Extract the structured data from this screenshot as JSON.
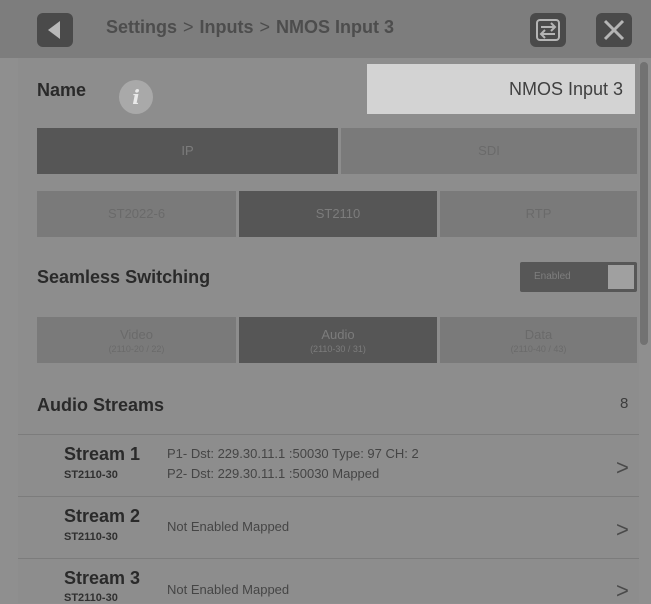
{
  "header": {
    "breadcrumb": [
      "Settings",
      "Inputs",
      "NMOS Input 3"
    ],
    "separator": ">"
  },
  "name_row": {
    "label": "Name",
    "info_glyph": "i",
    "value": "NMOS Input 3"
  },
  "interface": {
    "options": [
      {
        "label": "IP",
        "selected": true
      },
      {
        "label": "SDI",
        "selected": false
      }
    ]
  },
  "format": {
    "options": [
      {
        "label": "ST2022-6",
        "selected": false
      },
      {
        "label": "ST2110",
        "selected": true
      },
      {
        "label": "RTP",
        "selected": false
      }
    ]
  },
  "seamless": {
    "label": "Seamless Switching",
    "toggle_label": "Enabled"
  },
  "essence": {
    "options": [
      {
        "label": "Video",
        "sub": "(2110-20 / 22)",
        "selected": false
      },
      {
        "label": "Audio",
        "sub": "(2110-30 / 31)",
        "selected": true
      },
      {
        "label": "Data",
        "sub": "(2110-40 / 43)",
        "selected": false
      }
    ]
  },
  "streams_section": {
    "title": "Audio Streams",
    "count": "8"
  },
  "streams": [
    {
      "name": "Stream 1",
      "type": "ST2110-30",
      "line1": "P1- Dst: 229.30.11.1 :50030  Type: 97 CH: 2",
      "line2": "P2- Dst: 229.30.11.1 :50030  Mapped"
    },
    {
      "name": "Stream 2",
      "type": "ST2110-30",
      "line1": "Not Enabled  Mapped",
      "line2": ""
    },
    {
      "name": "Stream 3",
      "type": "ST2110-30",
      "line1": "Not Enabled  Mapped",
      "line2": ""
    }
  ],
  "chevron": ">",
  "icons": {
    "back": "back-arrow-icon",
    "swap": "swap-arrows-icon",
    "close": "close-x-icon",
    "info": "info-icon",
    "chevron": "chevron-right-icon"
  },
  "colors": {
    "background": "#8f8f8f",
    "selected_segment": "#565656",
    "unselected_segment": "#7a7a7a",
    "name_field": "#d3d3d3"
  }
}
